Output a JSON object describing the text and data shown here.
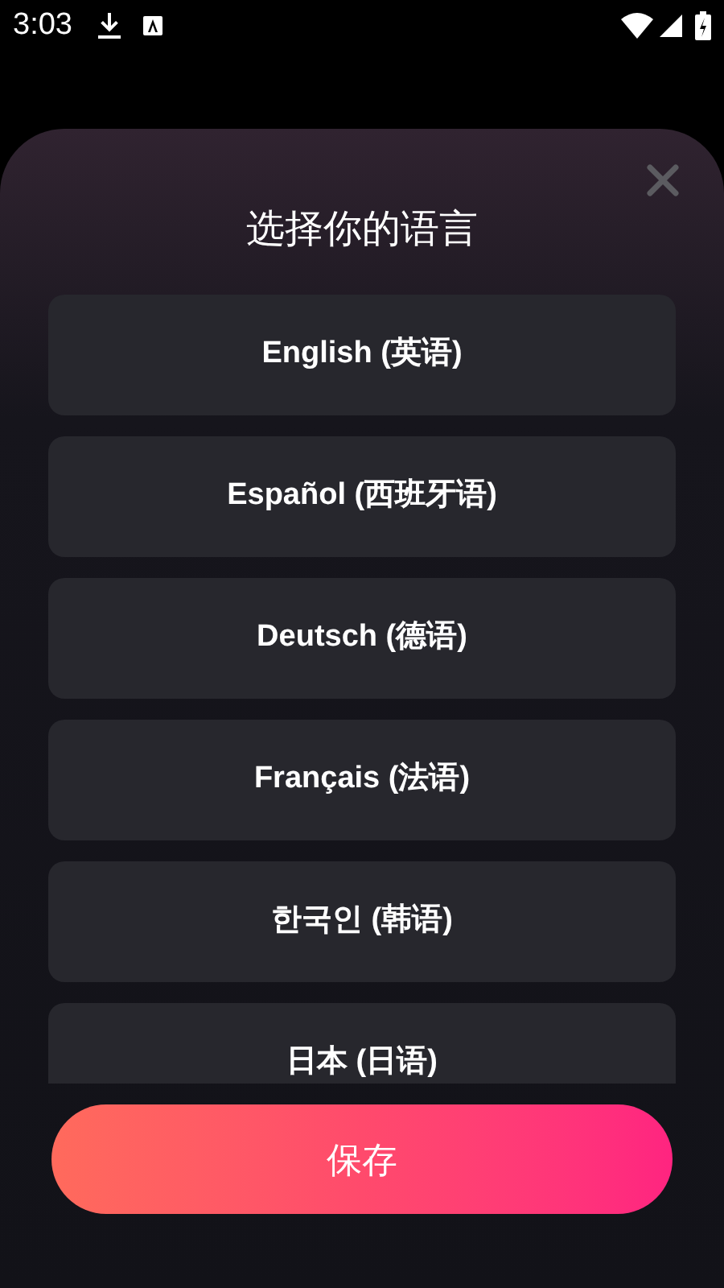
{
  "status_bar": {
    "time": "3:03"
  },
  "dialog": {
    "title": "选择你的语言",
    "languages": [
      {
        "label": "English (英语)"
      },
      {
        "label": "Español (西班牙语)"
      },
      {
        "label": "Deutsch (德语)"
      },
      {
        "label": "Français (法语)"
      },
      {
        "label": "한국인 (韩语)"
      },
      {
        "label": "日本 (日语)"
      }
    ],
    "save_button": "保存"
  }
}
